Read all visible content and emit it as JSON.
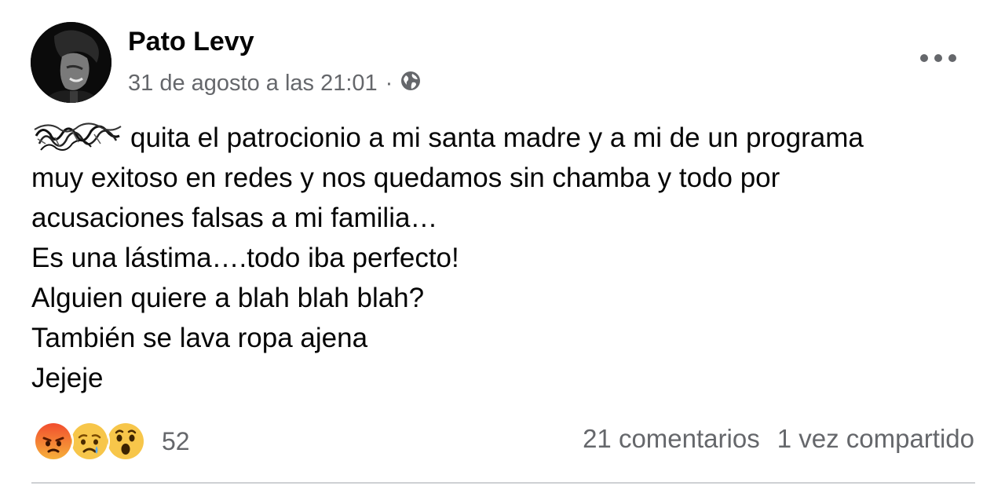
{
  "post": {
    "author": "Pato Levy",
    "timestamp": "31 de agosto a las 21:01",
    "separator": "·",
    "privacy_icon": "globe-icon",
    "more_icon": "more-options-icon",
    "body_lines": [
      "quita el patrocionio a mi santa madre y a mi de un programa",
      "muy exitoso en redes y nos quedamos sin chamba y todo por",
      "acusaciones falsas a mi familia…",
      "Es una lástima….todo iba perfecto!",
      "Alguien quiere a blah blah blah?",
      "También se lava ropa ajena",
      "Jejeje"
    ]
  },
  "reactions": {
    "icons": [
      "angry-reaction-icon",
      "sad-reaction-icon",
      "wow-reaction-icon"
    ],
    "count": "52"
  },
  "stats": {
    "comments": "21 comentarios",
    "shares": "1 vez compartido"
  }
}
